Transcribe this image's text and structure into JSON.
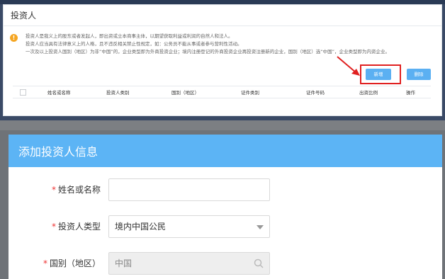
{
  "panel": {
    "title": "投资人",
    "notice": [
      "投资人是我义上的股东或者发起人，即出资或立本商事主体，以期望获取利益或利润的自然人和法人。",
      "投资人应当具有法律意义上的人格，且不违反相关禁止性规定，如：公务员不能从事或者参与营利性活动。",
      "一次及以上投资人国别（地区）为非“中国”的，企业类型即为外商投资企业；境内注册登记的外商投资企业再投资注册新的企业，国别（地区）选“中国”，企业类型即为内资企业。"
    ],
    "add_label": "新增",
    "delete_label": "删除",
    "columns": [
      "姓名或名称",
      "投资人类别",
      "国别（地区）",
      "证件类别",
      "证件号码",
      "出资比例",
      "操作"
    ]
  },
  "dialog": {
    "title": "添加投资人信息",
    "fields": [
      {
        "label": "姓名或名称",
        "value": "",
        "required": "*"
      },
      {
        "label": "投资人类型",
        "value": "境内中国公民",
        "required": "*"
      },
      {
        "label": "国别（地区）",
        "value": "中国",
        "required": "*"
      }
    ]
  },
  "colors": {
    "accent": "#5cb4f5",
    "button": "#5bb0f2",
    "highlight": "#e02020",
    "warning": "#f5a623"
  },
  "icons": [
    "warning-icon",
    "checkbox-icon",
    "arrow-annotation",
    "chevron-down-icon",
    "search-icon"
  ]
}
